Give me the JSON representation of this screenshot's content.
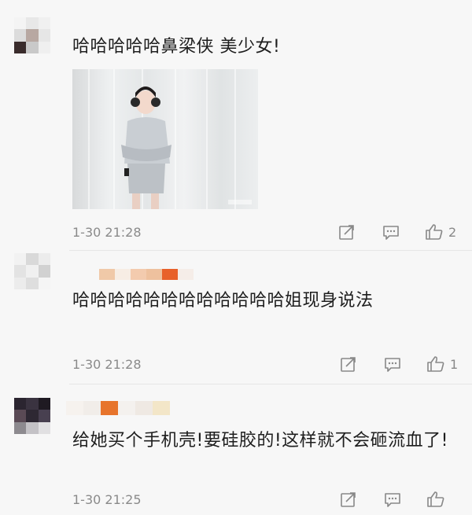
{
  "comments": [
    {
      "text": "哈哈哈哈哈鼻梁侠 美少女!",
      "time": "1-30 21:28",
      "likes": "2",
      "has_image": true
    },
    {
      "text": "哈哈哈哈哈哈哈哈哈哈哈哈姐现身说法",
      "time": "1-30 21:28",
      "likes": "1",
      "has_image": false
    },
    {
      "text": "给她买个手机壳!要硅胶的!这样就不会砸流血了!",
      "time": "1-30 21:25",
      "likes": "",
      "has_image": false
    }
  ],
  "icons": {
    "forward": "share-icon",
    "reply": "comment-icon",
    "like": "thumbs-up-icon"
  },
  "colors": {
    "background": "#f7f7f7",
    "meta_text": "#8a8a8a",
    "text": "#1e1e1e"
  }
}
